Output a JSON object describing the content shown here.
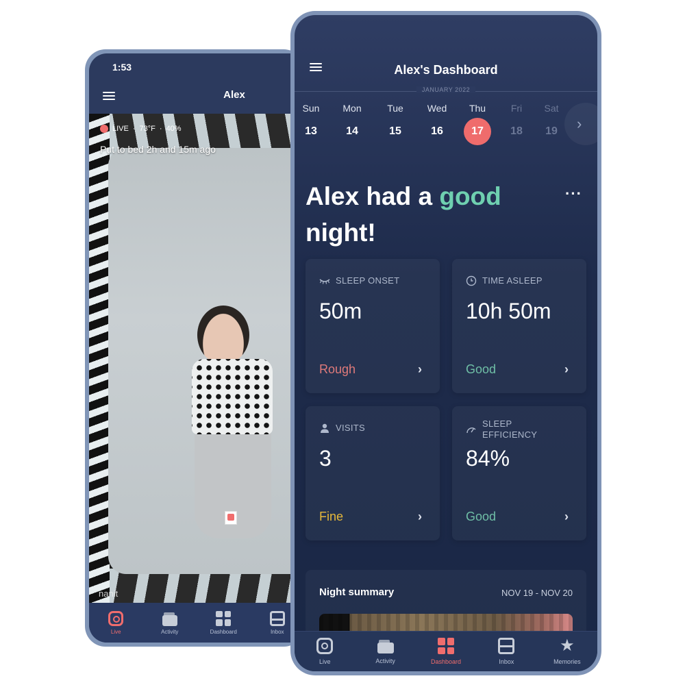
{
  "back_phone": {
    "status_time": "1:53",
    "header_title": "Alex",
    "live_overlay": {
      "live_label": "LIVE",
      "temperature": "73°F",
      "humidity": "40%",
      "separator": "·",
      "subtitle": "Put to bed 2h and 15m ago"
    },
    "brand_watermark": "nanit",
    "nav": [
      {
        "label": "Live",
        "icon": "live-camera-icon",
        "active": true
      },
      {
        "label": "Activity",
        "icon": "activity-icon",
        "active": false
      },
      {
        "label": "Dashboard",
        "icon": "dashboard-grid-icon",
        "active": false
      },
      {
        "label": "Inbox",
        "icon": "inbox-icon",
        "active": false
      }
    ]
  },
  "front_phone": {
    "header_title": "Alex's Dashboard",
    "month_label": "JANUARY 2022",
    "week": [
      {
        "name": "Sun",
        "num": "13",
        "state": "normal"
      },
      {
        "name": "Mon",
        "num": "14",
        "state": "normal"
      },
      {
        "name": "Tue",
        "num": "15",
        "state": "normal"
      },
      {
        "name": "Wed",
        "num": "16",
        "state": "normal"
      },
      {
        "name": "Thu",
        "num": "17",
        "state": "selected"
      },
      {
        "name": "Fri",
        "num": "18",
        "state": "dim"
      },
      {
        "name": "Sat",
        "num": "19",
        "state": "dim"
      }
    ],
    "next_arrow": "›",
    "headline": {
      "prefix": "Alex had a ",
      "accent": "good",
      "suffix": "night!"
    },
    "more_label": "···",
    "cards": [
      {
        "label": "SLEEP ONSET",
        "icon": "closed-eye-icon",
        "value": "50m",
        "status": "Rough",
        "status_color": "#e07a7a"
      },
      {
        "label": "TIME ASLEEP",
        "icon": "clock-icon",
        "value": "10h 50m",
        "status": "Good",
        "status_color": "#6fbfa6"
      },
      {
        "label": "VISITS",
        "icon": "person-icon",
        "value": "3",
        "status": "Fine",
        "status_color": "#e6b83a"
      },
      {
        "label": "SLEEP EFFICIENCY",
        "icon": "gauge-icon",
        "value": "84%",
        "status": "Good",
        "status_color": "#6fbfa6"
      }
    ],
    "card_arrow": "›",
    "summary": {
      "title": "Night summary",
      "date_range": "NOV 19 - NOV 20"
    },
    "nav": [
      {
        "label": "Live",
        "icon": "live-camera-icon",
        "active": false
      },
      {
        "label": "Activity",
        "icon": "activity-icon",
        "active": false
      },
      {
        "label": "Dashboard",
        "icon": "dashboard-grid-icon",
        "active": true
      },
      {
        "label": "Inbox",
        "icon": "inbox-icon",
        "active": false
      },
      {
        "label": "Memories",
        "icon": "star-icon",
        "active": false
      }
    ]
  },
  "colors": {
    "accent_red": "#ef6c6c",
    "accent_green": "#6fd0b0",
    "status_fine": "#e6b83a",
    "background_navy": "#1e2b4b",
    "frame": "#7f93b6"
  }
}
